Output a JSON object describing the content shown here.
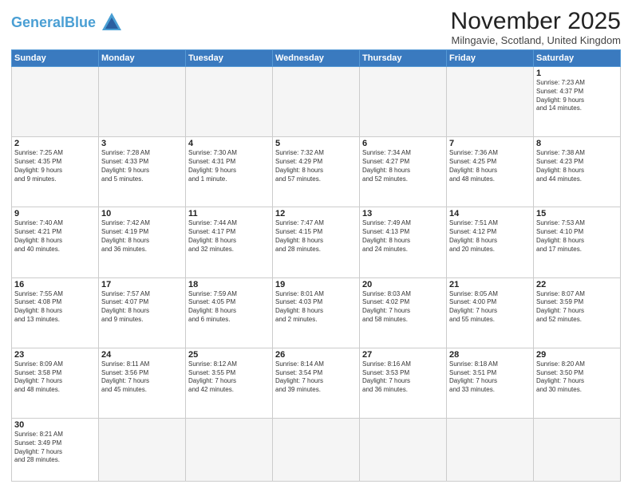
{
  "header": {
    "logo_general": "General",
    "logo_blue": "Blue",
    "title": "November 2025",
    "subtitle": "Milngavie, Scotland, United Kingdom"
  },
  "days_of_week": [
    "Sunday",
    "Monday",
    "Tuesday",
    "Wednesday",
    "Thursday",
    "Friday",
    "Saturday"
  ],
  "weeks": [
    [
      {
        "day": "",
        "info": ""
      },
      {
        "day": "",
        "info": ""
      },
      {
        "day": "",
        "info": ""
      },
      {
        "day": "",
        "info": ""
      },
      {
        "day": "",
        "info": ""
      },
      {
        "day": "",
        "info": ""
      },
      {
        "day": "1",
        "info": "Sunrise: 7:23 AM\nSunset: 4:37 PM\nDaylight: 9 hours\nand 14 minutes."
      }
    ],
    [
      {
        "day": "2",
        "info": "Sunrise: 7:25 AM\nSunset: 4:35 PM\nDaylight: 9 hours\nand 9 minutes."
      },
      {
        "day": "3",
        "info": "Sunrise: 7:28 AM\nSunset: 4:33 PM\nDaylight: 9 hours\nand 5 minutes."
      },
      {
        "day": "4",
        "info": "Sunrise: 7:30 AM\nSunset: 4:31 PM\nDaylight: 9 hours\nand 1 minute."
      },
      {
        "day": "5",
        "info": "Sunrise: 7:32 AM\nSunset: 4:29 PM\nDaylight: 8 hours\nand 57 minutes."
      },
      {
        "day": "6",
        "info": "Sunrise: 7:34 AM\nSunset: 4:27 PM\nDaylight: 8 hours\nand 52 minutes."
      },
      {
        "day": "7",
        "info": "Sunrise: 7:36 AM\nSunset: 4:25 PM\nDaylight: 8 hours\nand 48 minutes."
      },
      {
        "day": "8",
        "info": "Sunrise: 7:38 AM\nSunset: 4:23 PM\nDaylight: 8 hours\nand 44 minutes."
      }
    ],
    [
      {
        "day": "9",
        "info": "Sunrise: 7:40 AM\nSunset: 4:21 PM\nDaylight: 8 hours\nand 40 minutes."
      },
      {
        "day": "10",
        "info": "Sunrise: 7:42 AM\nSunset: 4:19 PM\nDaylight: 8 hours\nand 36 minutes."
      },
      {
        "day": "11",
        "info": "Sunrise: 7:44 AM\nSunset: 4:17 PM\nDaylight: 8 hours\nand 32 minutes."
      },
      {
        "day": "12",
        "info": "Sunrise: 7:47 AM\nSunset: 4:15 PM\nDaylight: 8 hours\nand 28 minutes."
      },
      {
        "day": "13",
        "info": "Sunrise: 7:49 AM\nSunset: 4:13 PM\nDaylight: 8 hours\nand 24 minutes."
      },
      {
        "day": "14",
        "info": "Sunrise: 7:51 AM\nSunset: 4:12 PM\nDaylight: 8 hours\nand 20 minutes."
      },
      {
        "day": "15",
        "info": "Sunrise: 7:53 AM\nSunset: 4:10 PM\nDaylight: 8 hours\nand 17 minutes."
      }
    ],
    [
      {
        "day": "16",
        "info": "Sunrise: 7:55 AM\nSunset: 4:08 PM\nDaylight: 8 hours\nand 13 minutes."
      },
      {
        "day": "17",
        "info": "Sunrise: 7:57 AM\nSunset: 4:07 PM\nDaylight: 8 hours\nand 9 minutes."
      },
      {
        "day": "18",
        "info": "Sunrise: 7:59 AM\nSunset: 4:05 PM\nDaylight: 8 hours\nand 6 minutes."
      },
      {
        "day": "19",
        "info": "Sunrise: 8:01 AM\nSunset: 4:03 PM\nDaylight: 8 hours\nand 2 minutes."
      },
      {
        "day": "20",
        "info": "Sunrise: 8:03 AM\nSunset: 4:02 PM\nDaylight: 7 hours\nand 58 minutes."
      },
      {
        "day": "21",
        "info": "Sunrise: 8:05 AM\nSunset: 4:00 PM\nDaylight: 7 hours\nand 55 minutes."
      },
      {
        "day": "22",
        "info": "Sunrise: 8:07 AM\nSunset: 3:59 PM\nDaylight: 7 hours\nand 52 minutes."
      }
    ],
    [
      {
        "day": "23",
        "info": "Sunrise: 8:09 AM\nSunset: 3:58 PM\nDaylight: 7 hours\nand 48 minutes."
      },
      {
        "day": "24",
        "info": "Sunrise: 8:11 AM\nSunset: 3:56 PM\nDaylight: 7 hours\nand 45 minutes."
      },
      {
        "day": "25",
        "info": "Sunrise: 8:12 AM\nSunset: 3:55 PM\nDaylight: 7 hours\nand 42 minutes."
      },
      {
        "day": "26",
        "info": "Sunrise: 8:14 AM\nSunset: 3:54 PM\nDaylight: 7 hours\nand 39 minutes."
      },
      {
        "day": "27",
        "info": "Sunrise: 8:16 AM\nSunset: 3:53 PM\nDaylight: 7 hours\nand 36 minutes."
      },
      {
        "day": "28",
        "info": "Sunrise: 8:18 AM\nSunset: 3:51 PM\nDaylight: 7 hours\nand 33 minutes."
      },
      {
        "day": "29",
        "info": "Sunrise: 8:20 AM\nSunset: 3:50 PM\nDaylight: 7 hours\nand 30 minutes."
      }
    ],
    [
      {
        "day": "30",
        "info": "Sunrise: 8:21 AM\nSunset: 3:49 PM\nDaylight: 7 hours\nand 28 minutes."
      },
      {
        "day": "",
        "info": ""
      },
      {
        "day": "",
        "info": ""
      },
      {
        "day": "",
        "info": ""
      },
      {
        "day": "",
        "info": ""
      },
      {
        "day": "",
        "info": ""
      },
      {
        "day": "",
        "info": ""
      }
    ]
  ]
}
